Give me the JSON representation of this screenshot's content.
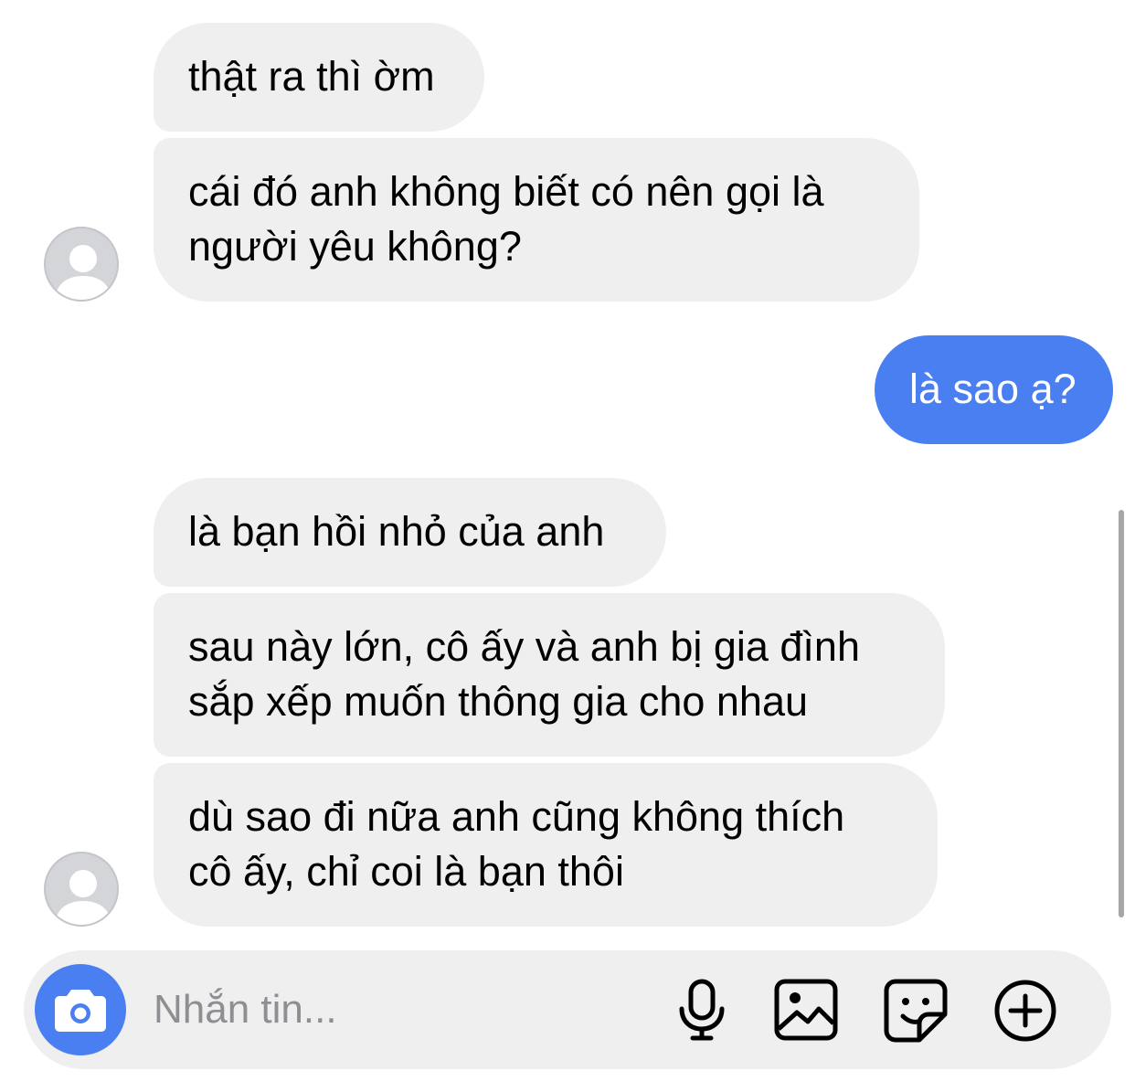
{
  "messages": [
    {
      "text": "thật ra thì ờm"
    },
    {
      "text": "cái đó anh không biết có nên gọi là\nngười yêu không?"
    },
    {
      "text": "là sao ạ?"
    },
    {
      "text": "là bạn hồi nhỏ của anh"
    },
    {
      "text": "sau này lớn, cô ấy và anh bị gia đình\nsắp xếp muốn thông gia cho nhau"
    },
    {
      "text": "dù sao đi nữa anh cũng không thích\ncô ấy, chỉ coi là bạn thôi"
    }
  ],
  "composer": {
    "placeholder": "Nhắn tin...",
    "value": ""
  },
  "icons": {
    "camera": "camera-icon",
    "microphone": "microphone-icon",
    "image": "image-icon",
    "sticker": "sticker-icon",
    "add": "plus-circle-icon"
  },
  "colors": {
    "incoming_bubble": "#efeff0",
    "outgoing_bubble": "#4a7ff2",
    "accent": "#4a7ff2"
  }
}
